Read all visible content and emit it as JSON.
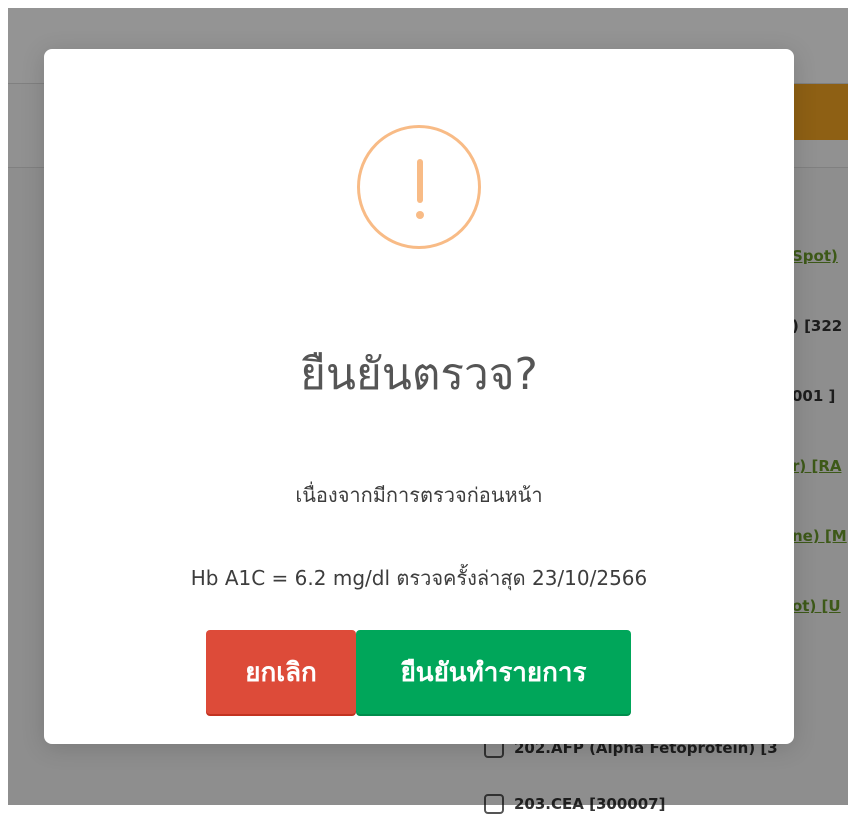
{
  "background": {
    "list_fragments": [
      "Spot)",
      ") [322",
      "001 ]",
      "r) [RA",
      "ne) [M",
      "ot) [U"
    ],
    "lower_items": [
      "202.AFP (Alpha Fetoprotein) [3",
      "203.CEA [300007]"
    ]
  },
  "dialog": {
    "icon": "exclamation-warning-icon",
    "icon_color": "#f8bb86",
    "title": "ยืนยันตรวจ?",
    "message_line1": "เนื่องจากมีการตรวจก่อนหน้า",
    "message_line2": "Hb A1C = 6.2 mg/dl ตรวจครั้งล่าสุด 23/10/2566",
    "cancel_label": "ยกเลิก",
    "confirm_label": "ยืนยันทำรายการ",
    "cancel_color": "#dd4b39",
    "confirm_color": "#00a65a"
  }
}
